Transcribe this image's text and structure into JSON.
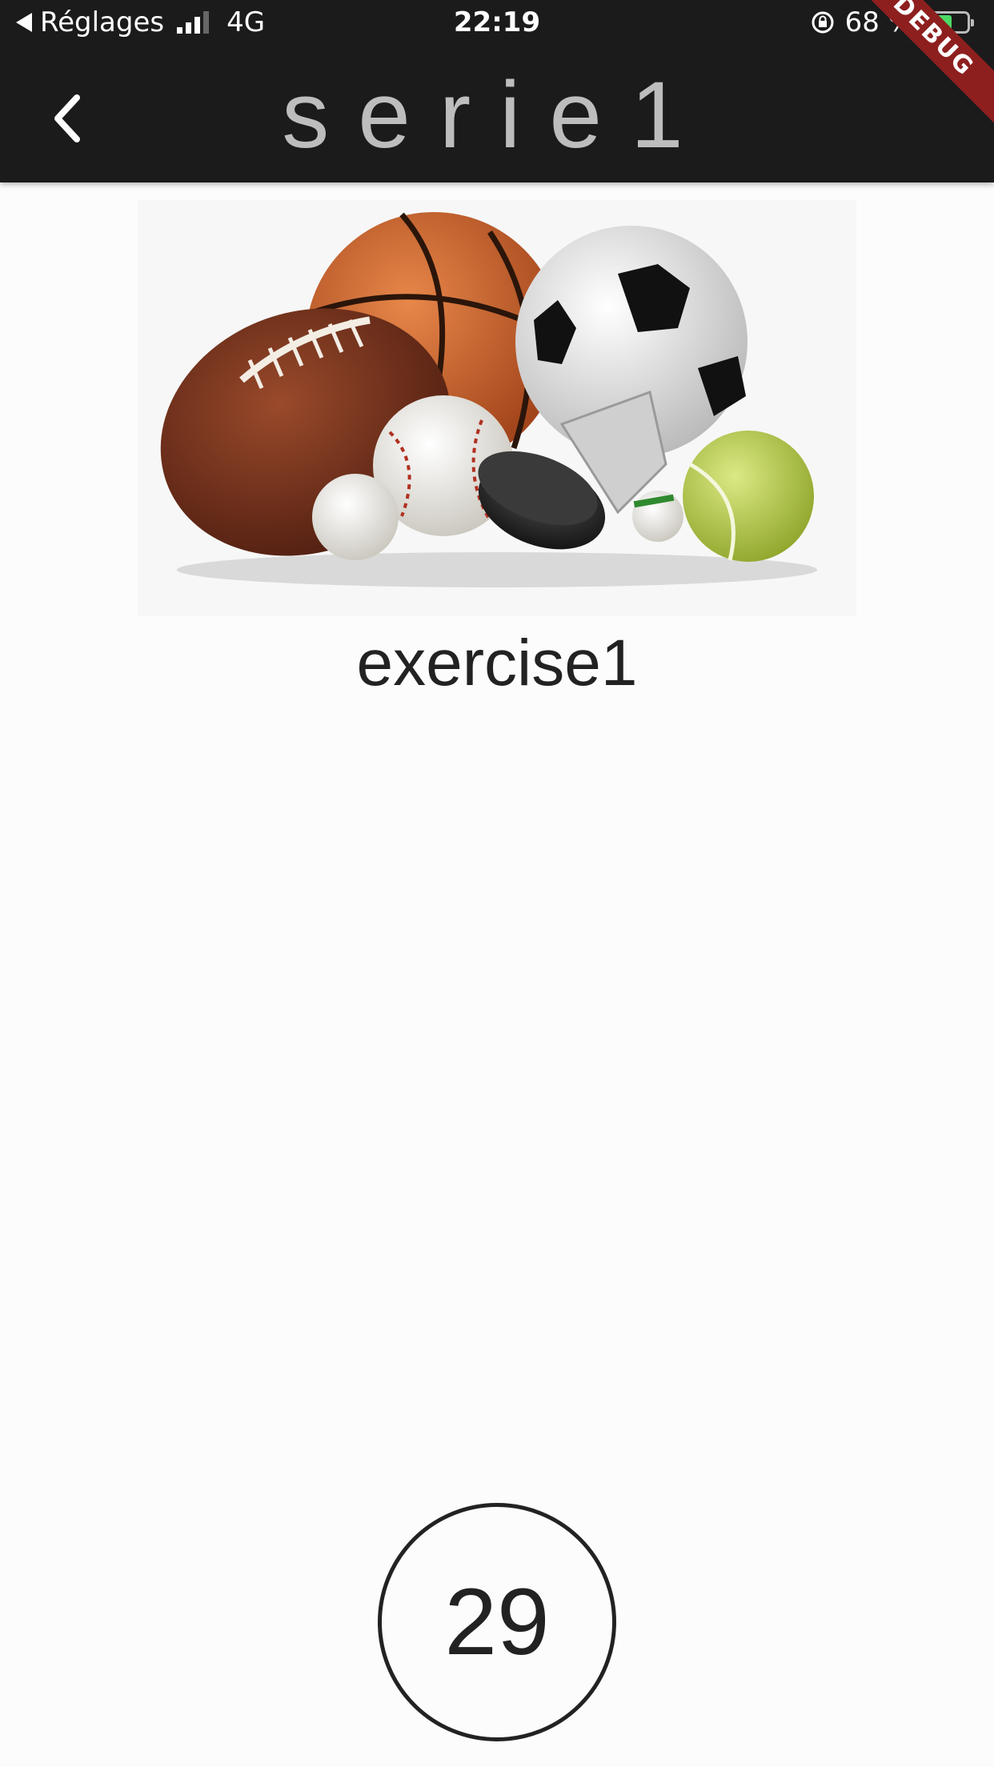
{
  "status_bar": {
    "back_app": "Réglages",
    "network": "4G",
    "time": "22:19",
    "battery_text": "68 %",
    "icons": [
      "back-arrow-icon",
      "signal-icon",
      "rotation-lock-icon",
      "battery-charging-icon"
    ]
  },
  "app_bar": {
    "title": "serie1",
    "back_icon": "chevron-left-icon",
    "debug_banner": "DEBUG",
    "colors": {
      "background": "#1b1b1b",
      "title": "#bdbdbd"
    }
  },
  "hero": {
    "image_description": "sports-balls"
  },
  "exercise": {
    "name": "exercise1"
  },
  "counter": {
    "value": "29"
  },
  "colors": {
    "debug_ribbon": "#8e1f1f",
    "page_background": "#fcfcfc"
  }
}
